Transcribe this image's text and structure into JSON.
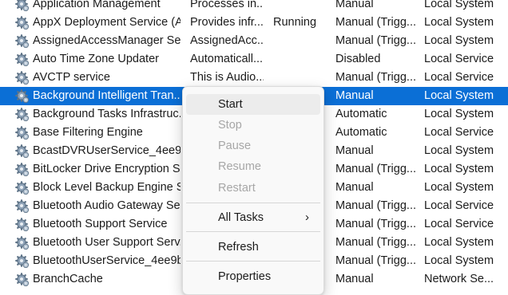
{
  "services": [
    {
      "name": "Application Management",
      "description": "Processes in...",
      "status": "",
      "startup": "Manual",
      "logon": "Local System"
    },
    {
      "name": "AppX Deployment Service (A...",
      "description": "Provides infr...",
      "status": "Running",
      "startup": "Manual (Trigg...",
      "logon": "Local System"
    },
    {
      "name": "AssignedAccessManager Ser...",
      "description": "AssignedAcc...",
      "status": "",
      "startup": "Manual (Trigg...",
      "logon": "Local System"
    },
    {
      "name": "Auto Time Zone Updater",
      "description": "Automaticall...",
      "status": "",
      "startup": "Disabled",
      "logon": "Local Service"
    },
    {
      "name": "AVCTP service",
      "description": "This is Audio...",
      "status": "",
      "startup": "Manual (Trigg...",
      "logon": "Local Service"
    },
    {
      "name": "Background Intelligent Tran...",
      "description": "",
      "status": "",
      "startup": "Manual",
      "logon": "Local System",
      "selected": true
    },
    {
      "name": "Background Tasks Infrastruc...",
      "description": "",
      "status": "",
      "startup": "Automatic",
      "logon": "Local System"
    },
    {
      "name": "Base Filtering Engine",
      "description": "",
      "status": "",
      "startup": "Automatic",
      "logon": "Local Service"
    },
    {
      "name": "BcastDVRUserService_4ee9b",
      "description": "",
      "status": "",
      "startup": "Manual",
      "logon": "Local System"
    },
    {
      "name": "BitLocker Drive Encryption S...",
      "description": "",
      "status": "",
      "startup": "Manual (Trigg...",
      "logon": "Local System"
    },
    {
      "name": "Block Level Backup Engine S...",
      "description": "",
      "status": "",
      "startup": "Manual",
      "logon": "Local System"
    },
    {
      "name": "Bluetooth Audio Gateway Se...",
      "description": "",
      "status": "",
      "startup": "Manual (Trigg...",
      "logon": "Local Service"
    },
    {
      "name": "Bluetooth Support Service",
      "description": "",
      "status": "",
      "startup": "Manual (Trigg...",
      "logon": "Local Service"
    },
    {
      "name": "Bluetooth User Support Serv...",
      "description": "",
      "status": "",
      "startup": "Manual (Trigg...",
      "logon": "Local System"
    },
    {
      "name": "BluetoothUserService_4ee9b",
      "description": "",
      "status": "",
      "startup": "Manual (Trigg...",
      "logon": "Local System"
    },
    {
      "name": "BranchCache",
      "description": "",
      "status": "",
      "startup": "Manual",
      "logon": "Network Se..."
    }
  ],
  "context_menu": {
    "start": "Start",
    "stop": "Stop",
    "pause": "Pause",
    "resume": "Resume",
    "restart": "Restart",
    "all_tasks": "All Tasks",
    "all_tasks_arrow": "›",
    "refresh": "Refresh",
    "properties": "Properties"
  },
  "icon": "service-gear-icon",
  "colors": {
    "selection": "#0b6fd6",
    "disabled_text": "#a7a7a7",
    "menu_hover": "#ececec"
  }
}
